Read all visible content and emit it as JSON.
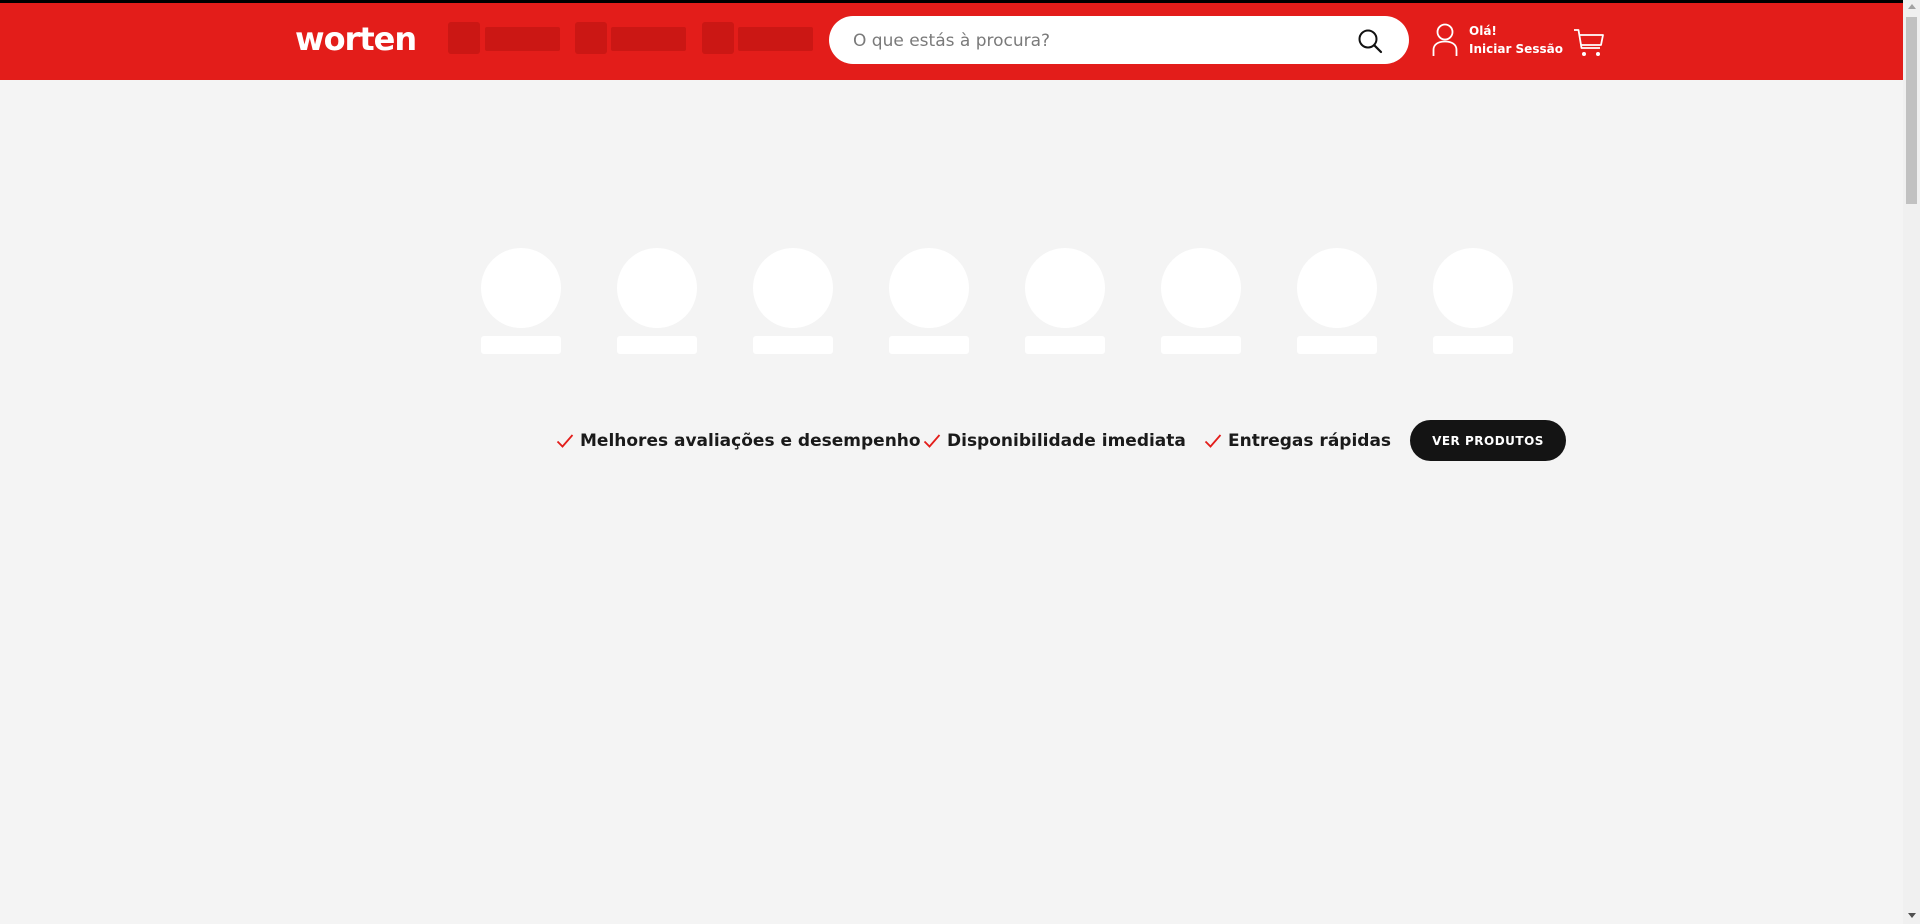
{
  "header": {
    "logo_text": "worten",
    "brand_color": "#e31d1a",
    "search": {
      "placeholder": "O que estás à procura?",
      "value": "",
      "icon": "search-icon"
    },
    "account": {
      "icon": "user-icon",
      "greeting": "Olá!",
      "login_label": "Iniciar Sessão"
    },
    "cart": {
      "icon": "cart-icon"
    }
  },
  "benefits": {
    "icon": "check-icon",
    "accent_color": "#e31d1a",
    "items": [
      "Melhores avaliações e desempenho",
      "Disponibilidade imediata",
      "Entregas rápidas"
    ]
  },
  "cta": {
    "label": "VER PRODUTOS",
    "color": "#141414"
  }
}
